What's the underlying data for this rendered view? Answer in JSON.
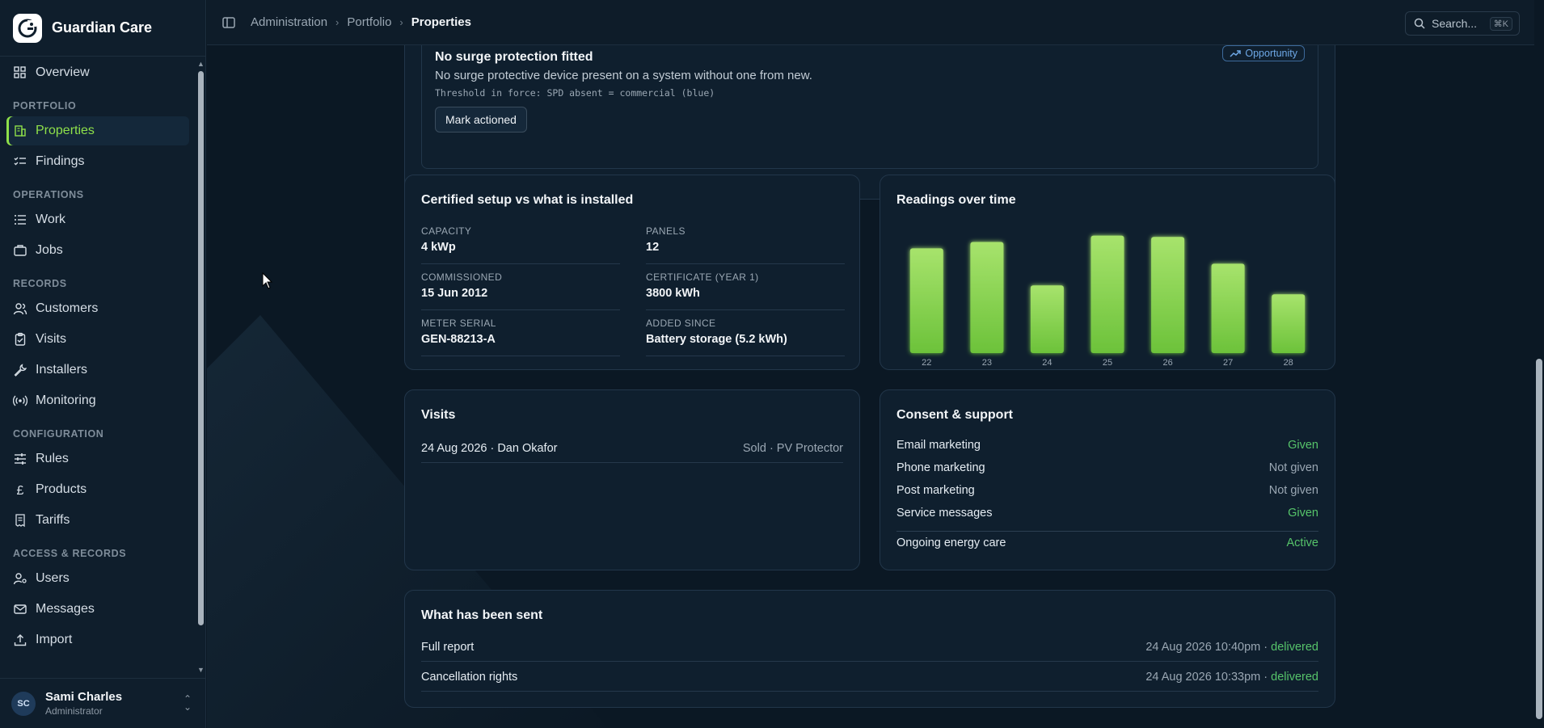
{
  "brand": {
    "name": "Guardian Care",
    "logo_text": "G"
  },
  "sidebar": {
    "items": [
      {
        "type": "item",
        "label": "Overview",
        "icon": "grid-icon"
      },
      {
        "type": "section",
        "label": "PORTFOLIO"
      },
      {
        "type": "item",
        "label": "Properties",
        "icon": "building-icon",
        "active": true
      },
      {
        "type": "item",
        "label": "Findings",
        "icon": "checklist-icon"
      },
      {
        "type": "section",
        "label": "OPERATIONS"
      },
      {
        "type": "item",
        "label": "Work",
        "icon": "list-icon"
      },
      {
        "type": "item",
        "label": "Jobs",
        "icon": "briefcase-icon"
      },
      {
        "type": "section",
        "label": "RECORDS"
      },
      {
        "type": "item",
        "label": "Customers",
        "icon": "users-icon"
      },
      {
        "type": "item",
        "label": "Visits",
        "icon": "clipboard-icon"
      },
      {
        "type": "item",
        "label": "Installers",
        "icon": "wrench-icon"
      },
      {
        "type": "item",
        "label": "Monitoring",
        "icon": "broadcast-icon"
      },
      {
        "type": "section",
        "label": "CONFIGURATION"
      },
      {
        "type": "item",
        "label": "Rules",
        "icon": "sliders-icon"
      },
      {
        "type": "item",
        "label": "Products",
        "icon": "pound-icon"
      },
      {
        "type": "item",
        "label": "Tariffs",
        "icon": "receipt-icon"
      },
      {
        "type": "section",
        "label": "ACCESS & RECORDS"
      },
      {
        "type": "item",
        "label": "Users",
        "icon": "user-key-icon"
      },
      {
        "type": "item",
        "label": "Messages",
        "icon": "mail-icon"
      },
      {
        "type": "item",
        "label": "Import",
        "icon": "upload-icon"
      }
    ]
  },
  "user": {
    "initials": "SC",
    "name": "Sami Charles",
    "role": "Administrator"
  },
  "topbar": {
    "breadcrumb": [
      "Administration",
      "Portfolio",
      "Properties"
    ],
    "search_label": "Search...",
    "search_shortcut": "⌘K"
  },
  "finding": {
    "title": "No surge protection fitted",
    "description": "No surge protective device present on a system without one from new.",
    "threshold": "Threshold in force: SPD absent = commercial (blue)",
    "badge": "Opportunity",
    "action_label": "Mark actioned"
  },
  "specs": {
    "title": "Certified setup vs what is installed",
    "fields": [
      {
        "label": "CAPACITY",
        "value": "4 kWp"
      },
      {
        "label": "PANELS",
        "value": "12"
      },
      {
        "label": "COMMISSIONED",
        "value": "15 Jun 2012"
      },
      {
        "label": "CERTIFICATE (YEAR 1)",
        "value": "3800 kWh"
      },
      {
        "label": "METER SERIAL",
        "value": "GEN-88213-A"
      },
      {
        "label": "ADDED SINCE",
        "value": "Battery storage (5.2 kWh)"
      }
    ]
  },
  "chart_data": {
    "type": "bar",
    "title": "Readings over time",
    "categories": [
      "22",
      "23",
      "24",
      "25",
      "26",
      "27",
      "28"
    ],
    "values": [
      82,
      87,
      53,
      92,
      91,
      70,
      46
    ],
    "ylim": [
      0,
      100
    ],
    "grid": false,
    "bar_color": "#8fd64e"
  },
  "visits": {
    "title": "Visits",
    "rows": [
      {
        "left": "24 Aug 2026 · Dan Okafor",
        "right": "Sold · PV Protector"
      }
    ]
  },
  "consent": {
    "title": "Consent & support",
    "rows": [
      {
        "label": "Email marketing",
        "value": "Given",
        "status": "positive"
      },
      {
        "label": "Phone marketing",
        "value": "Not given",
        "status": "neutral"
      },
      {
        "label": "Post marketing",
        "value": "Not given",
        "status": "neutral"
      },
      {
        "label": "Service messages",
        "value": "Given",
        "status": "positive"
      }
    ],
    "ongoing": {
      "label": "Ongoing energy care",
      "value": "Active",
      "status": "positive"
    }
  },
  "sent": {
    "title": "What has been sent",
    "rows": [
      {
        "label": "Full report",
        "timestamp": "24 Aug 2026 10:40pm",
        "separator": " · ",
        "status": "delivered"
      },
      {
        "label": "Cancellation rights",
        "timestamp": "24 Aug 2026 10:33pm",
        "separator": " · ",
        "status": "delivered"
      }
    ]
  },
  "colors": {
    "accent": "#8ee04a",
    "positive": "#56c46a",
    "badge_blue": "#6ea8e6",
    "background": "#0b1824",
    "card": "#0f1f2e"
  }
}
